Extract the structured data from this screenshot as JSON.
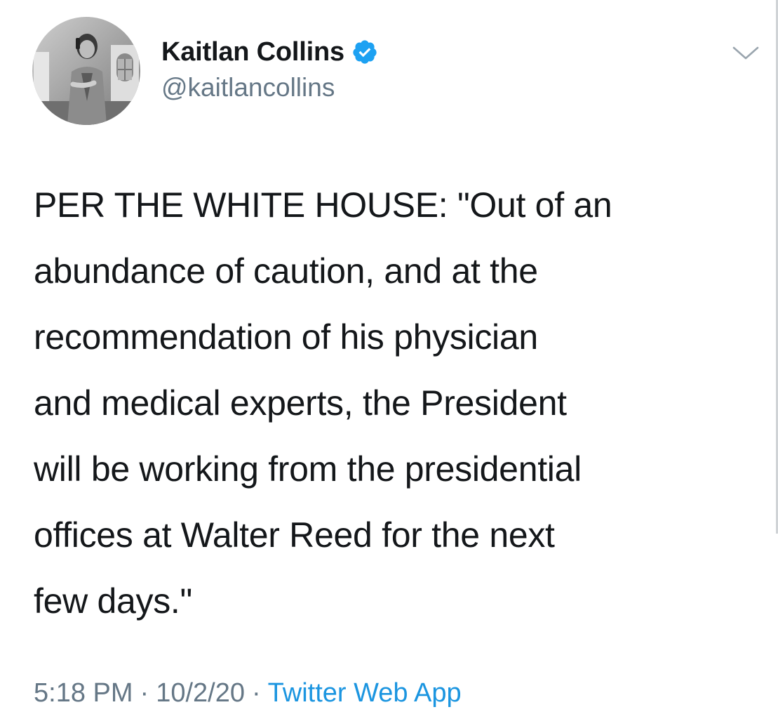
{
  "author": {
    "display_name": "Kaitlan Collins",
    "handle": "@kaitlancollins",
    "verified": true
  },
  "tweet": {
    "text": "PER THE WHITE HOUSE: \"Out of an\nabundance of caution, and at the\nrecommendation of his physician\nand medical experts, the President\nwill be working from the presidential\noffices at Walter Reed for the next\nfew days.\""
  },
  "meta": {
    "time": "5:18 PM",
    "date": "10/2/20",
    "separator": "·",
    "source": "Twitter Web App"
  },
  "icons": {
    "verified": "verified-badge-icon",
    "menu": "chevron-down-icon"
  },
  "colors": {
    "verified_blue": "#1da1f2",
    "link_blue": "#1b95e0",
    "secondary_text": "#657786",
    "primary_text": "#14171a"
  }
}
